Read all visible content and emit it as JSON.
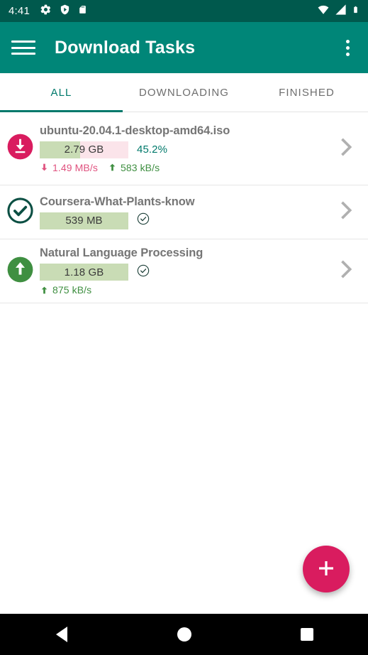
{
  "status_bar": {
    "time": "4:41",
    "left_icons": [
      "gear-icon",
      "shield-play-icon",
      "sd-card-icon"
    ],
    "right_icons": [
      "wifi-icon",
      "cellular-signal-icon",
      "battery-icon"
    ],
    "background_color": "#00594d"
  },
  "app_bar": {
    "title": "Download Tasks",
    "menu_icon": "hamburger-icon",
    "overflow_icon": "overflow-menu-icon",
    "background_color": "#008678"
  },
  "tabs": {
    "items": [
      {
        "label": "ALL",
        "active": true
      },
      {
        "label": "DOWNLOADING",
        "active": false
      },
      {
        "label": "FINISHED",
        "active": false
      }
    ],
    "active_color": "#00796b",
    "inactive_color": "#6e6e6e"
  },
  "tasks": [
    {
      "name": "ubuntu-20.04.1-desktop-amd64.iso",
      "status_icon": "download-circle-icon",
      "status_icon_color": "#d91c5f",
      "size": "2.79 GB",
      "percent_label": "45.2%",
      "percent_value": 45.2,
      "complete": false,
      "download_speed": "1.49 MB/s",
      "upload_speed": "583 kB/s",
      "chevron_icon": "chevron-right-icon"
    },
    {
      "name": "Coursera-What-Plants-know",
      "status_icon": "check-circle-outline-icon",
      "status_icon_color": "#0b4f43",
      "size": "539 MB",
      "percent_label": "",
      "percent_value": 100,
      "complete": true,
      "done_icon": "check-circle-small-icon",
      "download_speed": "",
      "upload_speed": "",
      "chevron_icon": "chevron-right-icon"
    },
    {
      "name": "Natural Language Processing",
      "status_icon": "upload-circle-icon",
      "status_icon_color": "#3f8f41",
      "size": "1.18 GB",
      "percent_label": "",
      "percent_value": 100,
      "complete": true,
      "done_icon": "check-circle-small-icon",
      "download_speed": "",
      "upload_speed": "875 kB/s",
      "chevron_icon": "chevron-right-icon"
    }
  ],
  "fab": {
    "icon": "plus-icon",
    "color": "#d91c5f"
  },
  "nav_bar": {
    "back_icon": "back-triangle-icon",
    "home_icon": "home-circle-icon",
    "recents_icon": "recents-square-icon"
  }
}
